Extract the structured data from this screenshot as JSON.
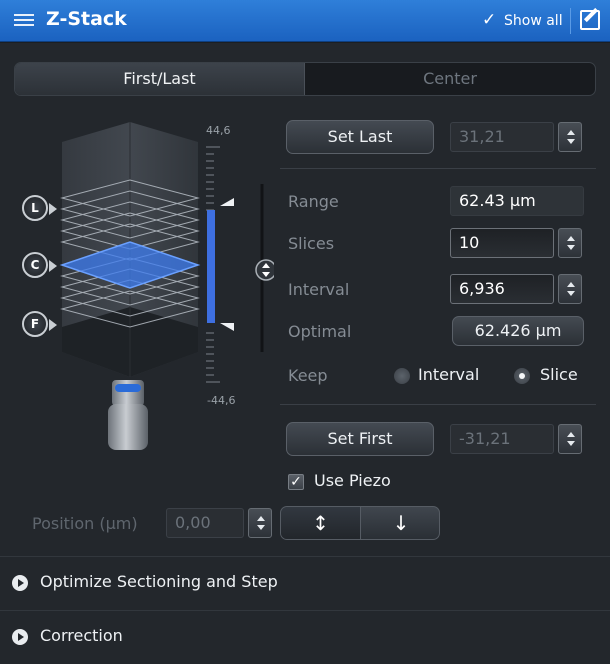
{
  "header": {
    "title": "Z-Stack",
    "show_all": "Show all"
  },
  "tabs": [
    {
      "label": "First/Last",
      "active": true
    },
    {
      "label": "Center",
      "active": false
    }
  ],
  "stack_graphic": {
    "top_value": "44,6",
    "bottom_value": "-44,6",
    "markers": [
      {
        "letter": "L"
      },
      {
        "letter": "C"
      },
      {
        "letter": "F"
      }
    ]
  },
  "set_last": {
    "label": "Set Last",
    "value": "31,21"
  },
  "range": {
    "label": "Range",
    "value": "62.43 µm"
  },
  "slices": {
    "label": "Slices",
    "value": "10"
  },
  "interval": {
    "label": "Interval",
    "value": "6,936"
  },
  "optimal": {
    "label": "Optimal",
    "value": "62.426 µm"
  },
  "keep": {
    "label": "Keep",
    "options": [
      {
        "label": "Interval",
        "selected": false
      },
      {
        "label": "Slice",
        "selected": true
      }
    ]
  },
  "set_first": {
    "label": "Set First",
    "value": "-31,21"
  },
  "use_piezo": {
    "label": "Use Piezo",
    "checked": true
  },
  "position": {
    "label": "Position (µm)",
    "value": "0,00"
  },
  "direction": {
    "both_icon": "↕",
    "down_icon": "↓"
  },
  "sections": [
    {
      "label": "Optimize Sectioning and Step"
    },
    {
      "label": "Correction"
    }
  ],
  "colors": {
    "title_bar": "#1f6ac8",
    "highlight": "#3d7cf0",
    "range_bar": "#3e6fe0"
  }
}
